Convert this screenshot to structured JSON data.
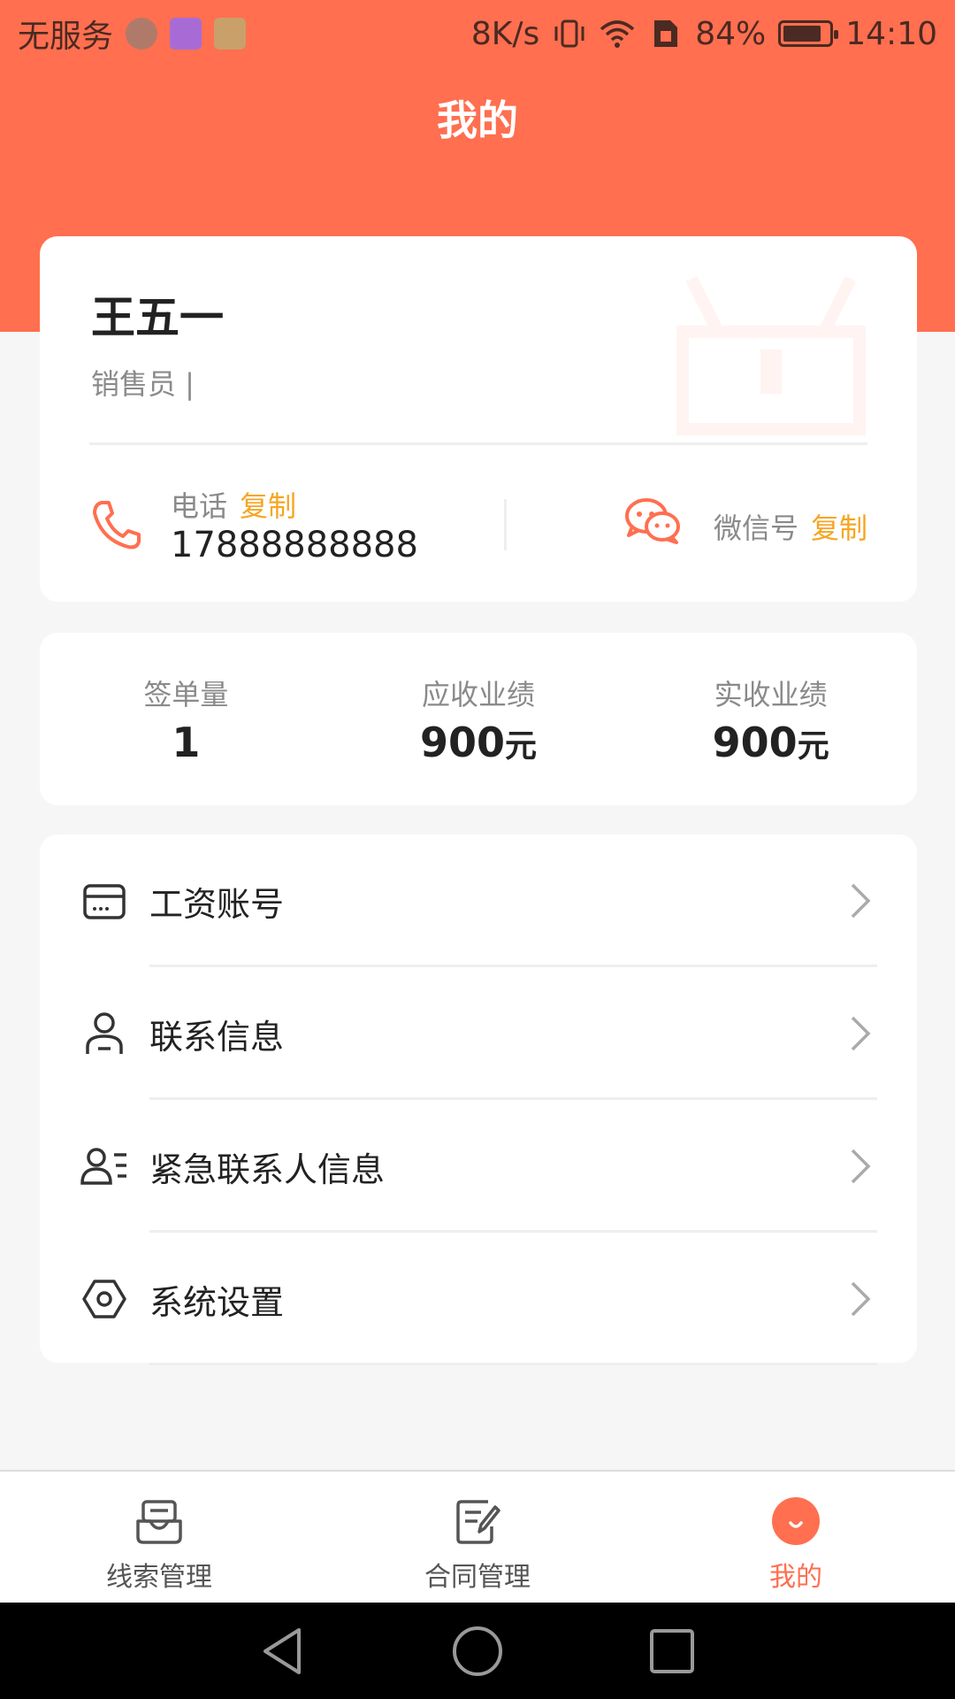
{
  "status_bar": {
    "carrier": "无服务",
    "speed": "8K/s",
    "battery": "84%",
    "battery_level": 0.84,
    "time": "14:10"
  },
  "header": {
    "title": "我的"
  },
  "profile": {
    "name": "王五一",
    "role": "销售员 |",
    "phone_label": "电话",
    "phone_copy": "复制",
    "phone_number": "17888888888",
    "wechat_label": "微信号",
    "wechat_copy": "复制",
    "icons": [
      "phone-icon",
      "wechat-icon"
    ]
  },
  "stats": [
    {
      "label": "签单量",
      "value": "1",
      "unit": ""
    },
    {
      "label": "应收业绩",
      "value": "900",
      "unit": "元"
    },
    {
      "label": "实收业绩",
      "value": "900",
      "unit": "元"
    }
  ],
  "menu": [
    {
      "label": "工资账号",
      "icon": "card-icon"
    },
    {
      "label": "联系信息",
      "icon": "person-icon"
    },
    {
      "label": "紧急联系人信息",
      "icon": "contact-list-icon"
    },
    {
      "label": "系统设置",
      "icon": "settings-icon"
    }
  ],
  "tabs": [
    {
      "label": "线索管理",
      "icon": "inbox-icon",
      "active": false
    },
    {
      "label": "合同管理",
      "icon": "document-edit-icon",
      "active": false
    },
    {
      "label": "我的",
      "icon": "smile-icon",
      "active": true
    }
  ],
  "colors": {
    "accent": "#ff6f50",
    "copy_link": "#f5a623",
    "background": "#f6f6f6"
  }
}
